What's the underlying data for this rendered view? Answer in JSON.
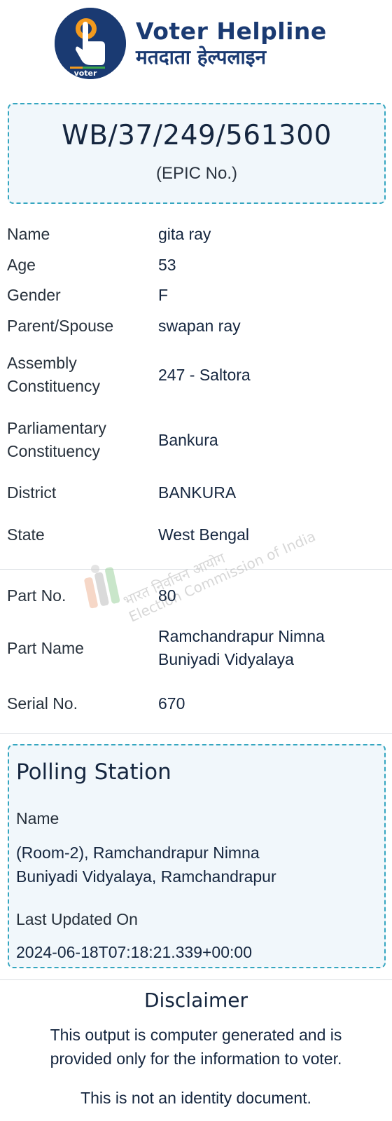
{
  "header": {
    "title_en": "Voter Helpline",
    "title_hi": "मतदाता हेल्पलाइन",
    "logo_text": "voter"
  },
  "epic": {
    "number": "WB/37/249/561300",
    "label": "(EPIC No.)"
  },
  "personal": {
    "name_label": "Name",
    "name_value": "gita ray",
    "age_label": "Age",
    "age_value": "53",
    "gender_label": "Gender",
    "gender_value": "F",
    "relation_label": "Parent/Spouse",
    "relation_value": "swapan ray",
    "ac_label_1": "Assembly",
    "ac_label_2": "Constituency",
    "ac_value": "247 - Saltora",
    "pc_label_1": "Parliamentary",
    "pc_label_2": "Constituency",
    "pc_value": "Bankura",
    "district_label": "District",
    "district_value": "BANKURA",
    "state_label": "State",
    "state_value": "West Bengal"
  },
  "part": {
    "part_no_label": "Part No.",
    "part_no_value": "80",
    "part_name_label": "Part Name",
    "part_name_line1": "Ramchandrapur Nimna",
    "part_name_line2": "Buniyadi Vidyalaya",
    "serial_label": "Serial No.",
    "serial_value": "670"
  },
  "watermark": {
    "hi_text": "भारत निर्वाचन आयोग",
    "en_text": "Election Commission of India"
  },
  "polling_station": {
    "title": "Polling Station",
    "name_label": "Name",
    "name_line1": "(Room-2), Ramchandrapur Nimna",
    "name_line2": "Buniyadi Vidyalaya, Ramchandrapur",
    "updated_label": "Last Updated On",
    "updated_value": "2024-06-18T07:18:21.339+00:00"
  },
  "disclaimer": {
    "title": "Disclaimer",
    "line1": "This output is computer generated and is",
    "line2": "provided only for the information to voter.",
    "note": "This is not an identity document."
  },
  "colors": {
    "brand": "#1a3a72",
    "dashed_border": "#35a6c0",
    "box_bg": "#f1f7fb",
    "logo_orange": "#f39a1e",
    "logo_green": "#3aa64a"
  },
  "icons": [
    "voter-helpline-logo",
    "eci-watermark-logo"
  ]
}
